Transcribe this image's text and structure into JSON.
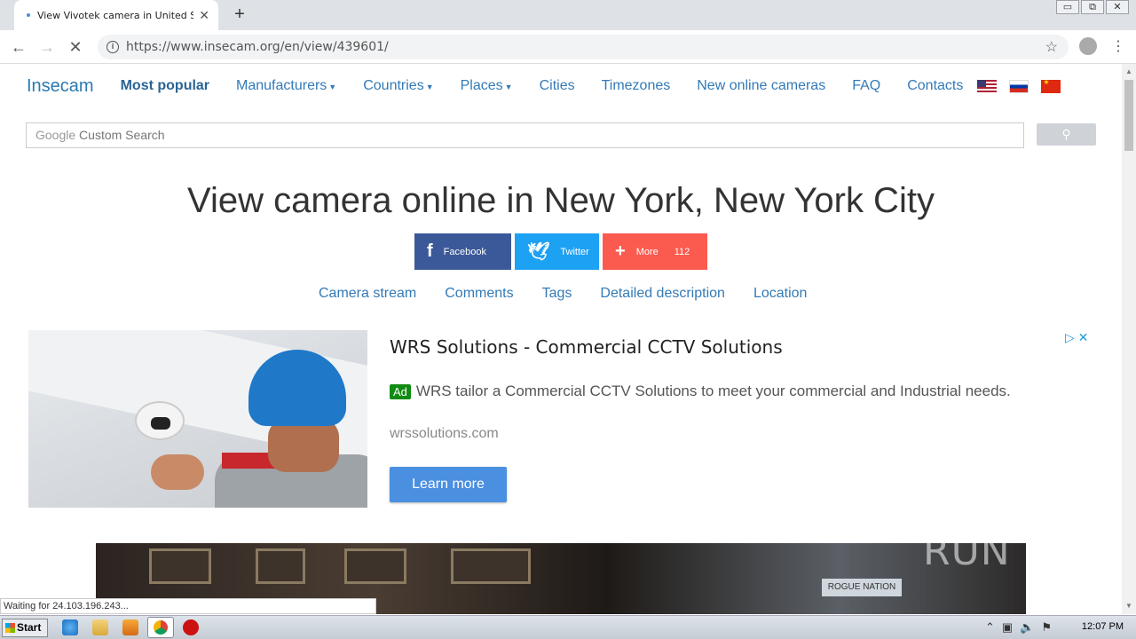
{
  "browser": {
    "tab_title": "View Vivotek camera in United States",
    "tab_close": "✕",
    "new_tab": "+",
    "url": "https://www.insecam.org/en/view/439601/",
    "window_controls": [
      "▭",
      "⧉",
      "✕"
    ]
  },
  "site": {
    "brand": "Insecam",
    "nav": [
      {
        "label": "Most popular",
        "dropdown": false
      },
      {
        "label": "Manufacturers",
        "dropdown": true
      },
      {
        "label": "Countries",
        "dropdown": true
      },
      {
        "label": "Places",
        "dropdown": true
      },
      {
        "label": "Cities",
        "dropdown": false
      },
      {
        "label": "Timezones",
        "dropdown": false
      },
      {
        "label": "New online cameras",
        "dropdown": false
      },
      {
        "label": "FAQ",
        "dropdown": false
      },
      {
        "label": "Contacts",
        "dropdown": false
      }
    ],
    "search": {
      "google": "Google",
      "placeholder": "Custom Search",
      "button_icon": "search-icon"
    },
    "heading": "View camera online in New York, New York City",
    "share": {
      "facebook": "Facebook",
      "twitter": "Twitter",
      "more": "More",
      "count": "112"
    },
    "subnav": [
      "Camera stream",
      "Comments",
      "Tags",
      "Detailed description",
      "Location"
    ]
  },
  "ad": {
    "title": "WRS Solutions - Commercial CCTV Solutions",
    "badge": "Ad",
    "description": "WRS tailor a Commercial CCTV Solutions to meet your commercial and Industrial needs.",
    "url": "wrssolutions.com",
    "cta": "Learn more"
  },
  "stream": {
    "sign_text": "ROGUE NATION",
    "watermark": "ANY ▷ RUN"
  },
  "statusbar": "Waiting for 24.103.196.243...",
  "taskbar": {
    "start": "Start",
    "clock": "12:07 PM"
  }
}
